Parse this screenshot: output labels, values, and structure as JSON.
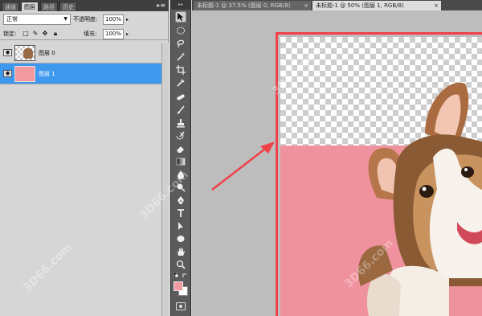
{
  "layers_panel": {
    "tabs": [
      "通道",
      "图层",
      "路径",
      "历史"
    ],
    "blend_mode": "正常",
    "opacity_label": "不透明度:",
    "opacity_value": "100%",
    "lock_label": "锁定:",
    "fill_label": "填充:",
    "fill_value": "100%",
    "layers": [
      {
        "name": "图层 0",
        "selected": false
      },
      {
        "name": "图层 1",
        "selected": true
      }
    ]
  },
  "document": {
    "tabs": [
      {
        "label": "未标题-1 @ 37.5% (图层 0, RGB/8)",
        "active": false
      },
      {
        "label": "未标题-1 @ 50% (图层 1, RGB/8)",
        "active": true
      }
    ]
  },
  "colors": {
    "foreground": "#f19aa0",
    "background": "#ffffff",
    "annotation": "#f04048",
    "selection": "#3d98ee"
  },
  "watermark": "3D66.com",
  "tools": [
    "move-tool-icon",
    "marquee-tool-icon",
    "lasso-tool-icon",
    "magic-wand-icon",
    "crop-tool-icon",
    "eyedropper-icon",
    "healing-brush-icon",
    "brush-tool-icon",
    "clone-stamp-icon",
    "history-brush-icon",
    "eraser-icon",
    "gradient-tool-icon",
    "blur-tool-icon",
    "dodge-tool-icon",
    "pen-tool-icon",
    "type-tool-icon",
    "path-select-icon",
    "shape-tool-icon",
    "hand-tool-icon",
    "zoom-tool-icon"
  ]
}
